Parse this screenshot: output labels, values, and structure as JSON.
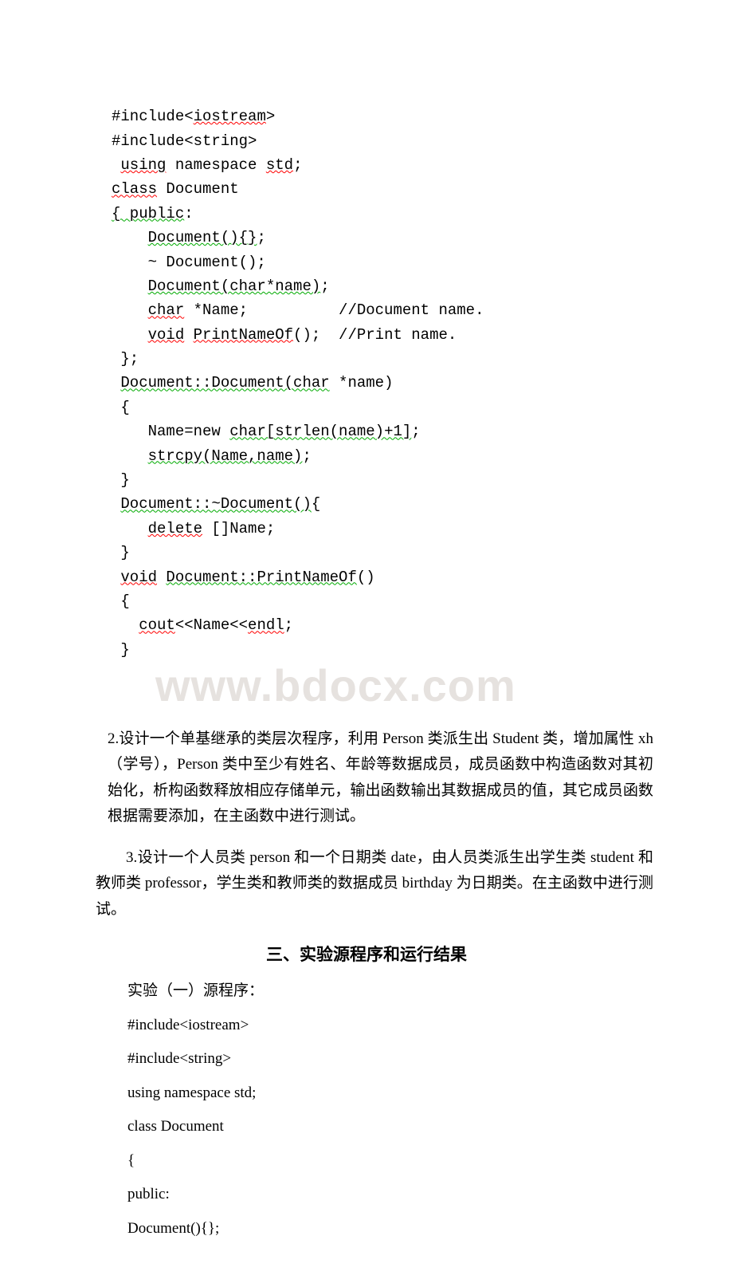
{
  "watermark": "www.bdocx.com",
  "code": {
    "lines": [
      {
        "segments": [
          {
            "t": "#include<",
            "c": ""
          },
          {
            "t": "iostream",
            "c": "squiggly-red"
          },
          {
            "t": ">",
            "c": ""
          }
        ]
      },
      {
        "segments": [
          {
            "t": "#include<string>",
            "c": ""
          }
        ]
      },
      {
        "segments": [
          {
            "t": " ",
            "c": ""
          },
          {
            "t": "using",
            "c": "squiggly-red"
          },
          {
            "t": " namespace ",
            "c": ""
          },
          {
            "t": "std",
            "c": "squiggly-red"
          },
          {
            "t": ";",
            "c": ""
          }
        ]
      },
      {
        "segments": [
          {
            "t": "class",
            "c": "squiggly-red"
          },
          {
            "t": " Document",
            "c": ""
          }
        ]
      },
      {
        "segments": [
          {
            "t": "{ public",
            "c": "squiggly-green"
          },
          {
            "t": ":",
            "c": ""
          }
        ]
      },
      {
        "segments": [
          {
            "t": "    ",
            "c": ""
          },
          {
            "t": "Document(){}",
            "c": "squiggly-green"
          },
          {
            "t": ";",
            "c": ""
          }
        ]
      },
      {
        "segments": [
          {
            "t": "    ~ Document();",
            "c": ""
          }
        ]
      },
      {
        "segments": [
          {
            "t": "    ",
            "c": ""
          },
          {
            "t": "Document(char*name)",
            "c": "squiggly-green"
          },
          {
            "t": ";",
            "c": ""
          }
        ]
      },
      {
        "segments": [
          {
            "t": "    ",
            "c": ""
          },
          {
            "t": "char",
            "c": "squiggly-red"
          },
          {
            "t": " *Name;          //Document name.",
            "c": ""
          }
        ]
      },
      {
        "segments": [
          {
            "t": "    ",
            "c": ""
          },
          {
            "t": "void",
            "c": "squiggly-red"
          },
          {
            "t": " ",
            "c": ""
          },
          {
            "t": "PrintNameOf",
            "c": "squiggly-red"
          },
          {
            "t": "();  //Print name.",
            "c": ""
          }
        ]
      },
      {
        "segments": [
          {
            "t": " };",
            "c": ""
          }
        ]
      },
      {
        "segments": [
          {
            "t": " ",
            "c": ""
          },
          {
            "t": "Document::Document(char",
            "c": "squiggly-green"
          },
          {
            "t": " *name)",
            "c": ""
          }
        ]
      },
      {
        "segments": [
          {
            "t": " {",
            "c": ""
          }
        ]
      },
      {
        "segments": [
          {
            "t": "    Name=new ",
            "c": ""
          },
          {
            "t": "char[strlen(name)+1]",
            "c": "squiggly-green"
          },
          {
            "t": ";",
            "c": ""
          }
        ]
      },
      {
        "segments": [
          {
            "t": "    ",
            "c": ""
          },
          {
            "t": "strcpy(Name,name)",
            "c": "squiggly-green"
          },
          {
            "t": ";",
            "c": ""
          }
        ]
      },
      {
        "segments": [
          {
            "t": " }",
            "c": ""
          }
        ]
      },
      {
        "segments": [
          {
            "t": " ",
            "c": ""
          },
          {
            "t": "Document::~Document()",
            "c": "squiggly-green"
          },
          {
            "t": "{",
            "c": ""
          }
        ]
      },
      {
        "segments": [
          {
            "t": "    ",
            "c": ""
          },
          {
            "t": "delete",
            "c": "squiggly-red"
          },
          {
            "t": " []Name;",
            "c": ""
          }
        ]
      },
      {
        "segments": [
          {
            "t": " }",
            "c": ""
          }
        ]
      },
      {
        "segments": [
          {
            "t": " ",
            "c": ""
          },
          {
            "t": "void",
            "c": "squiggly-red"
          },
          {
            "t": " ",
            "c": ""
          },
          {
            "t": "Document::PrintNameOf",
            "c": "squiggly-green"
          },
          {
            "t": "()",
            "c": ""
          }
        ]
      },
      {
        "segments": [
          {
            "t": " {",
            "c": ""
          }
        ]
      },
      {
        "segments": [
          {
            "t": "   ",
            "c": ""
          },
          {
            "t": "cout",
            "c": "squiggly-red"
          },
          {
            "t": "<<Name<<",
            "c": ""
          },
          {
            "t": "endl",
            "c": "squiggly-red"
          },
          {
            "t": ";",
            "c": ""
          }
        ]
      },
      {
        "segments": [
          {
            "t": " }",
            "c": ""
          }
        ]
      }
    ]
  },
  "para2": "2.设计一个单基继承的类层次程序，利用 Person 类派生出 Student 类，增加属性 xh（学号），Person 类中至少有姓名、年龄等数据成员，成员函数中构造函数对其初始化，析构函数释放相应存储单元，输出函数输出其数据成员的值，其它成员函数根据需要添加，在主函数中进行测试。",
  "para3": "3.设计一个人员类 person 和一个日期类 date，由人员类派生出学生类 student 和教师类 professor，学生类和教师类的数据成员 birthday 为日期类。在主函数中进行测试。",
  "heading3": "三、实验源程序和运行结果",
  "body": {
    "l1": "实验（一）源程序：",
    "l2": "#include<iostream>",
    "l3": "#include<string>",
    "l4": "using namespace std;",
    "l5": "class Document",
    "l6": "{",
    "l7": " public:",
    "l8": "  Document(){};"
  }
}
